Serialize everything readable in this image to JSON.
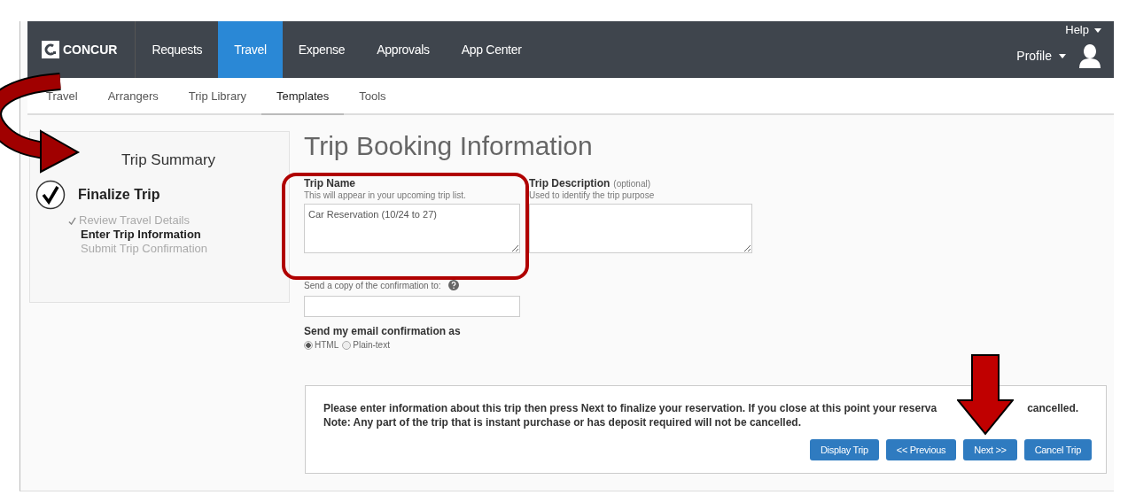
{
  "header": {
    "logo": "CONCUR",
    "nav": [
      {
        "label": "Requests",
        "selected": false
      },
      {
        "label": "Travel",
        "selected": true
      },
      {
        "label": "Expense",
        "selected": false
      },
      {
        "label": "Approvals",
        "selected": false
      },
      {
        "label": "App Center",
        "selected": false
      }
    ],
    "help": "Help",
    "profile": "Profile"
  },
  "subnav": [
    {
      "label": "Travel",
      "selected": false
    },
    {
      "label": "Arrangers",
      "selected": false
    },
    {
      "label": "Trip Library",
      "selected": false
    },
    {
      "label": "Templates",
      "selected": true
    },
    {
      "label": "Tools",
      "selected": false
    }
  ],
  "summary": {
    "title": "Trip Summary",
    "step": "Finalize Trip",
    "checked": true,
    "substeps": [
      {
        "label": "Review Travel Details",
        "kind": "done"
      },
      {
        "label": "Enter Trip Information",
        "kind": "current"
      },
      {
        "label": "Submit Trip Confirmation",
        "kind": "pending"
      }
    ]
  },
  "form": {
    "title": "Trip Booking Information",
    "trip_name": {
      "label": "Trip Name",
      "hint": "This will appear in your upcoming trip list.",
      "value": "Car Reservation (10/24 to 27)"
    },
    "trip_description": {
      "label": "Trip Description",
      "optional": "(optional)",
      "hint": "Used to identify the trip purpose"
    },
    "copy": {
      "label": "Send a copy of the confirmation to:"
    },
    "email_format": {
      "label": "Send my email confirmation as",
      "options": [
        {
          "label": "HTML",
          "selected": true
        },
        {
          "label": "Plain-text",
          "selected": false
        }
      ]
    }
  },
  "notice": {
    "line1": [
      "Please enter information about this trip then press Next to finalize your reservation. If you close at this point your reserva",
      "cancelled."
    ],
    "line2": "Note: Any part of the trip that is instant purchase or has deposit required will not be cancelled."
  },
  "buttons": [
    "Display Trip",
    "<< Previous",
    "Next >>",
    "Cancel Trip"
  ]
}
